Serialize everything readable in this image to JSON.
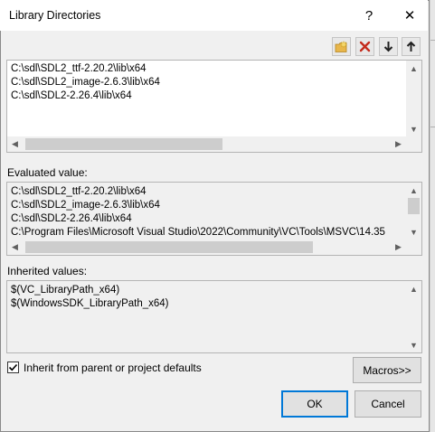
{
  "window": {
    "title": "Library Directories",
    "help_glyph": "?",
    "close_glyph": "✕"
  },
  "toolbar": {
    "new_line_icon": "new-folder-icon",
    "delete_icon": "delete-x-icon",
    "move_down_icon": "arrow-down-icon",
    "move_up_icon": "arrow-up-icon"
  },
  "editor": {
    "lines": [
      "C:\\sdl\\SDL2_ttf-2.20.2\\lib\\x64",
      "C:\\sdl\\SDL2_image-2.6.3\\lib\\x64",
      "C:\\sdl\\SDL2-2.26.4\\lib\\x64"
    ]
  },
  "evaluated": {
    "label": "Evaluated value:",
    "lines": [
      "C:\\sdl\\SDL2_ttf-2.20.2\\lib\\x64",
      "C:\\sdl\\SDL2_image-2.6.3\\lib\\x64",
      "C:\\sdl\\SDL2-2.26.4\\lib\\x64",
      "C:\\Program Files\\Microsoft Visual Studio\\2022\\Community\\VC\\Tools\\MSVC\\14.35"
    ]
  },
  "inherited": {
    "label": "Inherited values:",
    "lines": [
      "$(VC_LibraryPath_x64)",
      "$(WindowsSDK_LibraryPath_x64)"
    ]
  },
  "options": {
    "inherit_label": "Inherit from parent or project defaults",
    "inherit_checked": true,
    "macros_label": "Macros>>"
  },
  "buttons": {
    "ok": "OK",
    "cancel": "Cancel"
  },
  "colors": {
    "accent": "#0078d7",
    "delete_red": "#c42b1c",
    "folder_yellow": "#e8b64a"
  }
}
